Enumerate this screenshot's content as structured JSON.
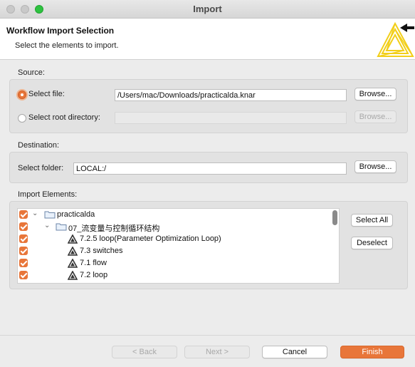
{
  "window": {
    "title": "Import"
  },
  "banner": {
    "title": "Workflow Import Selection",
    "description": "Select the elements to import."
  },
  "source": {
    "label": "Source:",
    "select_file_label": "Select file:",
    "select_file_value": "/Users/mac/Downloads/practicalda.knar",
    "select_root_label": "Select root directory:",
    "select_root_value": "",
    "browse_label": "Browse...",
    "browse_root_label": "Browse...",
    "selected_option": "Select file:"
  },
  "destination": {
    "label": "Destination:",
    "folder_label": "Select folder:",
    "folder_value": "LOCAL:/",
    "browse_label": "Browse..."
  },
  "import_elements": {
    "label": "Import Elements:",
    "select_all_label": "Select All",
    "deselect_label": "Deselect",
    "tree": [
      {
        "text": "practicalda",
        "type": "folder",
        "level": 0,
        "checked": true,
        "expanded": true
      },
      {
        "text": "07_流变量与控制循环结构",
        "type": "folder",
        "level": 1,
        "checked": true,
        "expanded": true
      },
      {
        "text": "7.2.5 loop(Parameter Optimization Loop)",
        "type": "workflow",
        "level": 2,
        "checked": true
      },
      {
        "text": "7.3 switches",
        "type": "workflow",
        "level": 2,
        "checked": true
      },
      {
        "text": "7.1 flow",
        "type": "workflow",
        "level": 2,
        "checked": true
      },
      {
        "text": "7.2 loop",
        "type": "workflow",
        "level": 2,
        "checked": true
      }
    ]
  },
  "footer": {
    "back_label": "< Back",
    "next_label": "Next >",
    "cancel_label": "Cancel",
    "finish_label": "Finish"
  },
  "colors": {
    "accent": "#e8763a",
    "logo_yellow": "#f2cf1a"
  }
}
